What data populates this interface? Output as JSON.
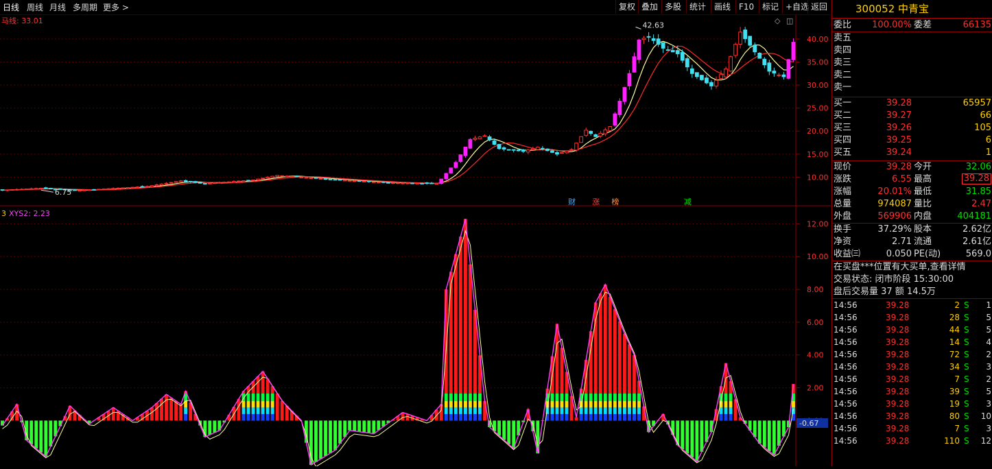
{
  "toolbar": {
    "period_tabs": [
      "日线",
      "周线",
      "月线",
      "多周期",
      "更多 >"
    ],
    "buttons": [
      "复权",
      "叠加",
      "多股",
      "统计",
      "画线",
      "F10",
      "标记",
      "+自选",
      "返回"
    ]
  },
  "main_panel": {
    "indicator_label": "马线: 33.01",
    "high_annotation": "42.63",
    "low_annotation": "6.75",
    "markers": [
      {
        "text": "财",
        "color": "#4aa8ff",
        "day": 118
      },
      {
        "text": "涨",
        "color": "#ff4040",
        "day": 123
      },
      {
        "text": "榜",
        "color": "#ff9040",
        "day": 127
      },
      {
        "text": "减",
        "color": "#00e000",
        "day": 142
      }
    ],
    "y_ticks": [
      "10.00",
      "15.00",
      "20.00",
      "25.00",
      "30.00",
      "35.00",
      "40.00"
    ]
  },
  "sub_panel": {
    "indicator_prefix": "3",
    "indicator_label": "XYS2: 2.23",
    "y_ticks": [
      "0.00",
      "2.00",
      "4.00",
      "6.00",
      "8.00",
      "10.00",
      "12.00"
    ],
    "current_value_tag": "-0.67"
  },
  "chart_data": [
    {
      "type": "candlestick",
      "title": "",
      "ylim": [
        5,
        44
      ],
      "x_count": 165,
      "y_ticks": [
        10,
        15,
        20,
        25,
        30,
        35,
        40
      ],
      "price_path_keypoints": [
        [
          0,
          7.2
        ],
        [
          8,
          7.6
        ],
        [
          15,
          7.1
        ],
        [
          22,
          7.5
        ],
        [
          30,
          8.0
        ],
        [
          37,
          9.2
        ],
        [
          42,
          8.6
        ],
        [
          52,
          9.4
        ],
        [
          57,
          10.4
        ],
        [
          62,
          10.0
        ],
        [
          70,
          9.4
        ],
        [
          80,
          8.8
        ],
        [
          90,
          8.6
        ],
        [
          91,
          9.6
        ],
        [
          94,
          13.2
        ],
        [
          97,
          18.2
        ],
        [
          100,
          19.0
        ],
        [
          103,
          16.2
        ],
        [
          108,
          15.6
        ],
        [
          111,
          16.5
        ],
        [
          115,
          15.0
        ],
        [
          118,
          16.0
        ],
        [
          121,
          20.2
        ],
        [
          123,
          18.8
        ],
        [
          126,
          21.0
        ],
        [
          128,
          26.5
        ],
        [
          130,
          32.5
        ],
        [
          132,
          39.8
        ],
        [
          134,
          40.5
        ],
        [
          137,
          38.0
        ],
        [
          140,
          36.8
        ],
        [
          143,
          32.5
        ],
        [
          147,
          29.8
        ],
        [
          150,
          33.5
        ],
        [
          153,
          41.5
        ],
        [
          156,
          37.2
        ],
        [
          159,
          33.0
        ],
        [
          162,
          31.8
        ],
        [
          164,
          39.3
        ]
      ],
      "moving_averages": [
        {
          "name": "",
          "color": "#ffffa0",
          "window": 6
        },
        {
          "name": "",
          "color": "#ff2a2a",
          "window": 10
        }
      ]
    },
    {
      "type": "bar",
      "title": "XYS2",
      "ylim": [
        -2.7,
        12.6
      ],
      "y_ticks": [
        0,
        2,
        4,
        6,
        8,
        10,
        12
      ],
      "series_keypoints": [
        [
          0,
          -0.3
        ],
        [
          3,
          1.0
        ],
        [
          5,
          -1.2
        ],
        [
          9,
          -2.2
        ],
        [
          14,
          0.9
        ],
        [
          18,
          -0.2
        ],
        [
          23,
          0.8
        ],
        [
          27,
          0.0
        ],
        [
          31,
          0.8
        ],
        [
          34,
          1.6
        ],
        [
          37,
          1.0
        ],
        [
          38,
          1.8
        ],
        [
          42,
          -1.0
        ],
        [
          45,
          -0.6
        ],
        [
          50,
          1.8
        ],
        [
          54,
          3.0
        ],
        [
          58,
          1.2
        ],
        [
          62,
          0.0
        ],
        [
          64,
          -2.7
        ],
        [
          69,
          -1.8
        ],
        [
          72,
          -0.6
        ],
        [
          77,
          -0.8
        ],
        [
          83,
          0.5
        ],
        [
          88,
          0.0
        ],
        [
          91,
          1.0
        ],
        [
          92,
          8.0
        ],
        [
          96,
          12.3
        ],
        [
          100,
          1.2
        ],
        [
          101,
          -0.4
        ],
        [
          106,
          -1.7
        ],
        [
          109,
          0.7
        ],
        [
          111,
          -2.0
        ],
        [
          115,
          5.9
        ],
        [
          118,
          1.5
        ],
        [
          119,
          0.2
        ],
        [
          123,
          7.2
        ],
        [
          125,
          8.3
        ],
        [
          129,
          5.3
        ],
        [
          131,
          4.0
        ],
        [
          134,
          -0.7
        ],
        [
          137,
          0.4
        ],
        [
          140,
          -1.5
        ],
        [
          144,
          -2.5
        ],
        [
          147,
          -0.7
        ],
        [
          150,
          3.5
        ],
        [
          153,
          0.2
        ],
        [
          157,
          -1.4
        ],
        [
          160,
          -2.1
        ],
        [
          163,
          -0.4
        ],
        [
          164,
          2.23
        ]
      ]
    }
  ],
  "quote_panel": {
    "title": "300052 中青宝",
    "weibi": {
      "label": "委比",
      "value": "100.00%",
      "label2": "委差",
      "value2": "66135"
    },
    "sell_levels": [
      "卖五",
      "卖四",
      "卖三",
      "卖二",
      "卖一"
    ],
    "buy_levels": [
      {
        "label": "买一",
        "price": "39.28",
        "vol": "65957"
      },
      {
        "label": "买二",
        "price": "39.27",
        "vol": "66"
      },
      {
        "label": "买三",
        "price": "39.26",
        "vol": "105"
      },
      {
        "label": "买四",
        "price": "39.25",
        "vol": "6"
      },
      {
        "label": "买五",
        "price": "39.24",
        "vol": "1"
      }
    ],
    "stats1": [
      {
        "l": "现价",
        "v": "39.28",
        "vc": "red",
        "l2": "今开",
        "v2": "32.06",
        "v2c": "grn",
        "box": false
      },
      {
        "l": "涨跌",
        "v": "6.55",
        "vc": "red",
        "l2": "最高",
        "v2": "39.28",
        "v2c": "red",
        "box": true
      },
      {
        "l": "涨幅",
        "v": "20.01%",
        "vc": "red",
        "l2": "最低",
        "v2": "31.85",
        "v2c": "grn",
        "box": false
      },
      {
        "l": "总量",
        "v": "974087",
        "vc": "yel",
        "l2": "量比",
        "v2": "2.47",
        "v2c": "red",
        "box": false
      },
      {
        "l": "外盘",
        "v": "569906",
        "vc": "red",
        "l2": "内盘",
        "v2": "404181",
        "v2c": "grn",
        "box": false
      }
    ],
    "stats2": [
      {
        "l": "换手",
        "v": "37.29%",
        "l2": "股本",
        "v2": "2.62亿"
      },
      {
        "l": "净资",
        "v": "2.71",
        "l2": "流通",
        "v2": "2.61亿"
      },
      {
        "l": "收益㈢",
        "v": "0.050",
        "l2": "PE(动)",
        "v2": "569.0"
      }
    ],
    "notes": [
      "在买盘***位置有大买单,查看详情",
      "交易状态: 闭市阶段 15:30:00",
      "盘后交易量 37 额 14.5万"
    ],
    "ticks": [
      {
        "t": "14:56",
        "p": "39.28",
        "v": "2",
        "s": "S",
        "n": "1"
      },
      {
        "t": "14:56",
        "p": "39.28",
        "v": "28",
        "s": "S",
        "n": "5"
      },
      {
        "t": "14:56",
        "p": "39.28",
        "v": "44",
        "s": "S",
        "n": "5"
      },
      {
        "t": "14:56",
        "p": "39.28",
        "v": "14",
        "s": "S",
        "n": "4"
      },
      {
        "t": "14:56",
        "p": "39.28",
        "v": "72",
        "s": "S",
        "n": "2"
      },
      {
        "t": "14:56",
        "p": "39.28",
        "v": "34",
        "s": "S",
        "n": "3"
      },
      {
        "t": "14:56",
        "p": "39.28",
        "v": "7",
        "s": "S",
        "n": "2"
      },
      {
        "t": "14:56",
        "p": "39.28",
        "v": "39",
        "s": "S",
        "n": "5"
      },
      {
        "t": "14:56",
        "p": "39.28",
        "v": "19",
        "s": "S",
        "n": "3"
      },
      {
        "t": "14:56",
        "p": "39.28",
        "v": "80",
        "s": "S",
        "n": "10"
      },
      {
        "t": "14:56",
        "p": "39.28",
        "v": "7",
        "s": "S",
        "n": "3"
      },
      {
        "t": "14:56",
        "p": "39.28",
        "v": "110",
        "s": "S",
        "n": "12"
      }
    ]
  }
}
